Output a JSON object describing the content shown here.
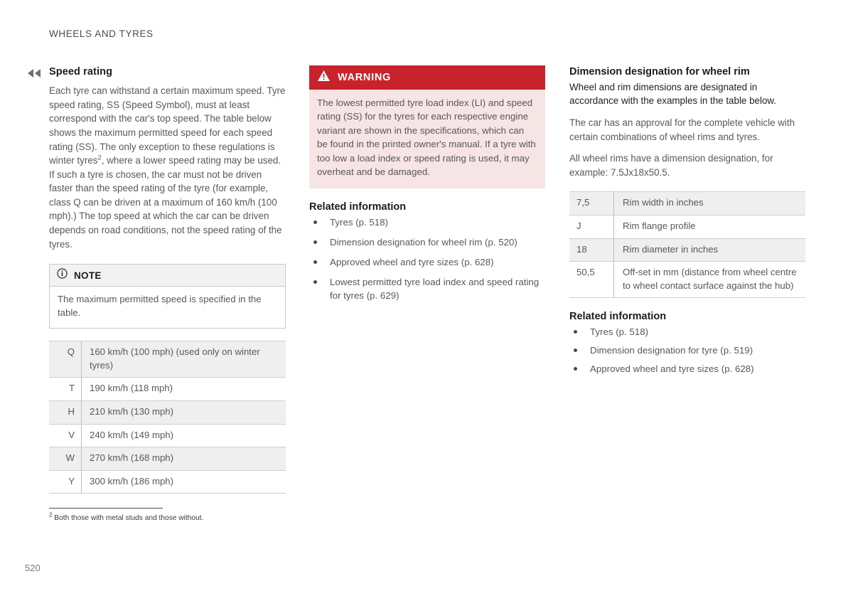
{
  "page": {
    "running_head": "WHEELS AND TYRES",
    "folio": "520",
    "continuation_icon": "double-chevron-left-icon"
  },
  "column_left": {
    "section_title": "Speed rating",
    "body_part1": "Each tyre can withstand a certain maximum speed. Tyre speed rating, SS (Speed Symbol), must at least correspond with the car's top speed. The table below shows the maximum permitted speed for each speed rating (SS). The only exception to these regulations is winter tyres",
    "footnote_marker": "2",
    "body_part2": ", where a lower speed rating may be used. If such a tyre is chosen, the car must not be driven faster than the speed rating of the tyre (for example, class Q can be driven at a maximum of 160 km/h (100 mph).) The top speed at which the car can be driven depends on road conditions, not the speed rating of the tyres.",
    "note": {
      "icon": "info-circle-icon",
      "title": "NOTE",
      "text": "The maximum permitted speed is specified in the table."
    },
    "speed_table": {
      "rows": [
        {
          "key": "Q",
          "value": "160 km/h (100 mph) (used only on winter tyres)",
          "shaded": true
        },
        {
          "key": "T",
          "value": "190 km/h (118 mph)",
          "shaded": false
        },
        {
          "key": "H",
          "value": "210 km/h (130 mph)",
          "shaded": true
        },
        {
          "key": "V",
          "value": "240 km/h (149 mph)",
          "shaded": false
        },
        {
          "key": "W",
          "value": "270 km/h (168 mph)",
          "shaded": true
        },
        {
          "key": "Y",
          "value": "300 km/h (186 mph)",
          "shaded": false
        }
      ]
    },
    "footnote": {
      "marker": "2",
      "text": "Both those with metal studs and those without."
    }
  },
  "column_middle": {
    "warning": {
      "icon": "warning-triangle-icon",
      "title": "WARNING",
      "text": "The lowest permitted tyre load index (LI) and speed rating (SS) for the tyres for each respective engine variant are shown in the specifications, which can be found in the printed owner's manual. If a tyre with too low a load index or speed rating is used, it may overheat and be damaged."
    },
    "related": {
      "title": "Related information",
      "items": [
        "Tyres (p. 518)",
        "Dimension designation for wheel rim (p. 520)",
        "Approved wheel and tyre sizes (p. 628)",
        "Lowest permitted tyre load index and speed rating for tyres (p. 629)"
      ]
    }
  },
  "column_right": {
    "section_title": "Dimension designation for wheel rim",
    "lead_text": "Wheel and rim dimensions are designated in accordance with the examples in the table below.",
    "body_text_1": "The car has an approval for the complete vehicle with certain combinations of wheel rims and tyres.",
    "body_text_2": "All wheel rims have a dimension designation, for example: 7.5Jx18x50.5.",
    "rim_table": {
      "rows": [
        {
          "key": "7,5",
          "value": "Rim width in inches",
          "shaded": true
        },
        {
          "key": "J",
          "value": "Rim flange profile",
          "shaded": false
        },
        {
          "key": "18",
          "value": "Rim diameter in inches",
          "shaded": true
        },
        {
          "key": "50,5",
          "value": "Off-set in mm (distance from wheel centre to wheel contact surface against the hub)",
          "shaded": false
        }
      ]
    },
    "related": {
      "title": "Related information",
      "items": [
        "Tyres (p. 518)",
        "Dimension designation for tyre (p. 519)",
        "Approved wheel and tyre sizes (p. 628)"
      ]
    }
  },
  "colors": {
    "warning_header": "#c8232c",
    "warning_body": "#f7e4e4",
    "note_header": "#f2f2f2",
    "table_shaded_row": "#efefef"
  }
}
